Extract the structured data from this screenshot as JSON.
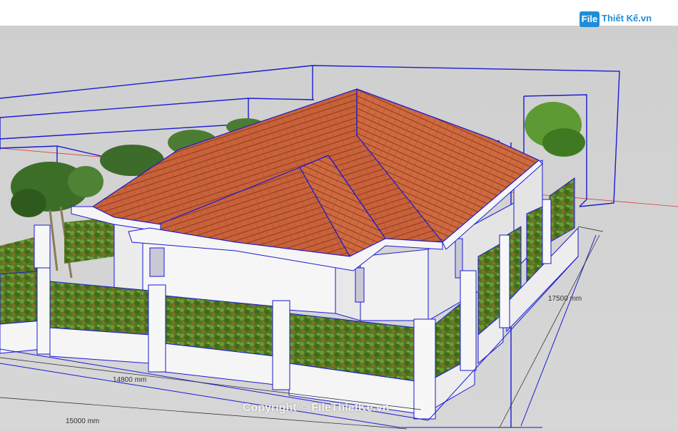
{
  "viewport": {
    "dimensions": {
      "width_total": "14800 mm",
      "outer_width": "15000 mm",
      "depth": "17500 mm"
    }
  },
  "watermark": {
    "logo_badge": "File",
    "logo_text": "Thiết Kế.vn",
    "copyright": "Copyright © FileThietKe.vn"
  },
  "colors": {
    "selection": "#1a1ad6",
    "roof": "#c9623a",
    "ground": "#d3d3d3",
    "wall": "#f4f4f4",
    "hedge": "#5f8a2a"
  }
}
